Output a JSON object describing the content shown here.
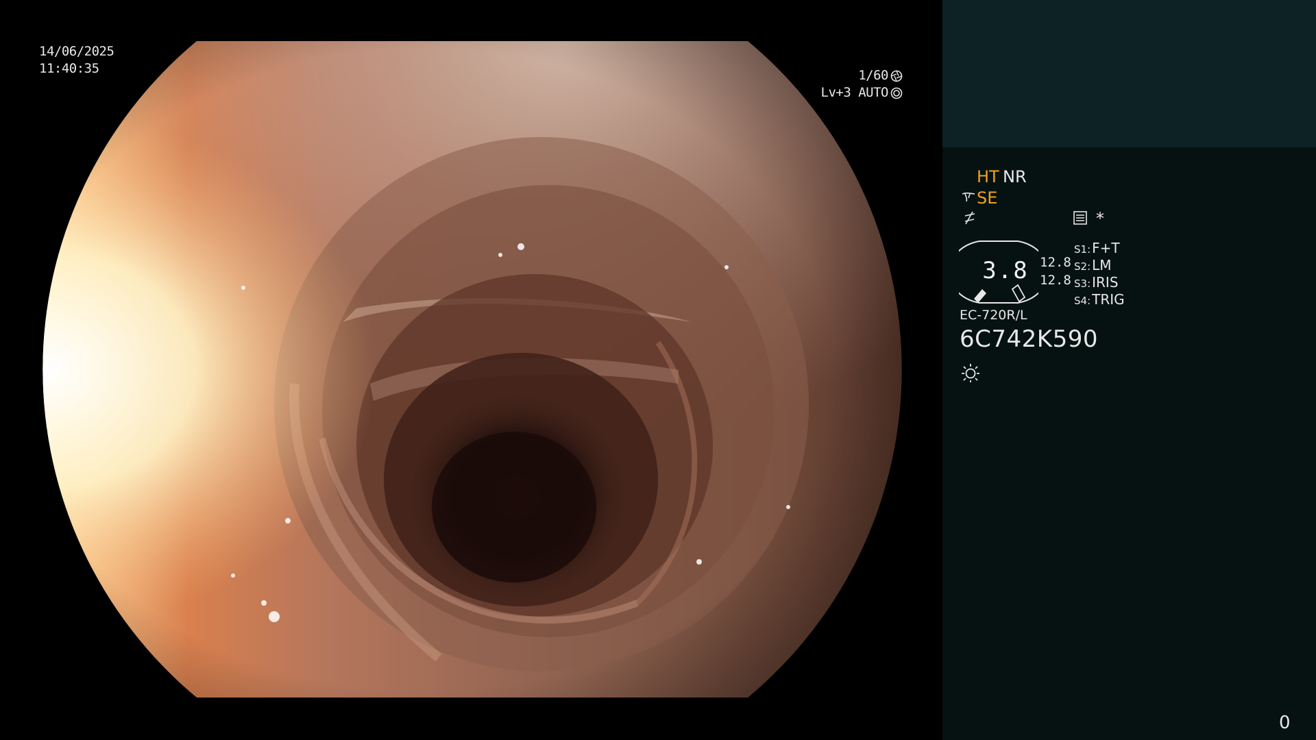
{
  "view": {
    "date": "14/06/2025",
    "time": "11:40:35",
    "shutter": "1/60",
    "level": "Lv+3 AUTO",
    "shutter_icon": "aperture-icon",
    "auto_icon": "auto-iris-icon"
  },
  "panel": {
    "ht": "HT",
    "nr": "NR",
    "se": "SE",
    "star": "*",
    "dial_value": "3.8",
    "value_a": "12.8",
    "value_b": "12.8",
    "switches": [
      {
        "key": "S1:",
        "value": "F+T"
      },
      {
        "key": "S2:",
        "value": "LM"
      },
      {
        "key": "S3:",
        "value": "IRIS"
      },
      {
        "key": "S4:",
        "value": "TRIG"
      }
    ],
    "model": "EC-720R/L",
    "serial": "6C742K590",
    "icons": [
      "se-mode-icon",
      "lightning-icon",
      "menu-icon",
      "light-icon"
    ],
    "colors": {
      "amber": "#f0a21e",
      "panel_top": "#0c2225",
      "panel": "#061211"
    }
  },
  "counter": "0"
}
